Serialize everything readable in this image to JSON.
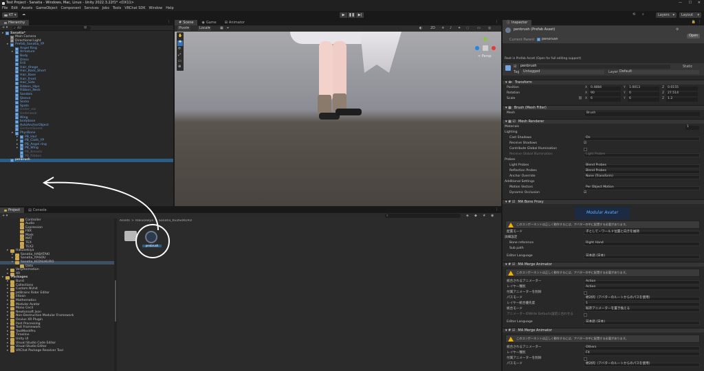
{
  "window": {
    "title": "Test Project - Sanatia - Windows, Mac, Linux - Unity 2022.3.22f1* <DX11>"
  },
  "menu": [
    "File",
    "Edit",
    "Assets",
    "GameObject",
    "Component",
    "Services",
    "Jobs",
    "Tools",
    "VRChat SDK",
    "Window",
    "Help"
  ],
  "toolbar": {
    "account": "KT",
    "layers": "Layers",
    "layout": "Layout"
  },
  "hierarchy": {
    "tab": "Hierarchy",
    "search_label": "All",
    "rows": [
      {
        "label": "Sanatia*",
        "i": 0,
        "c": "bold"
      },
      {
        "label": "Main Camera",
        "i": 1,
        "c": "go"
      },
      {
        "label": "Directional Light",
        "i": 1,
        "c": "go"
      },
      {
        "label": "Prefab_Sanatia_YP",
        "i": 1,
        "c": "blue"
      },
      {
        "label": "Angel Ring",
        "i": 2,
        "c": "blue"
      },
      {
        "label": "Armature",
        "i": 2,
        "c": "blue"
      },
      {
        "label": "Body",
        "i": 2,
        "c": "blue"
      },
      {
        "label": "Dress",
        "i": 2,
        "c": "blue"
      },
      {
        "label": "Frill",
        "i": 2,
        "c": "blue"
      },
      {
        "label": "Hair_Ahoge",
        "i": 2,
        "c": "blue"
      },
      {
        "label": "Hair_Back_Short",
        "i": 2,
        "c": "blue"
      },
      {
        "label": "Hair_Base",
        "i": 2,
        "c": "blue"
      },
      {
        "label": "Hair_Front",
        "i": 2,
        "c": "blue"
      },
      {
        "label": "Hair_Side",
        "i": 2,
        "c": "blue"
      },
      {
        "label": "Ribbon_Hips",
        "i": 2,
        "c": "blue"
      },
      {
        "label": "Ribbon_Neck",
        "i": 2,
        "c": "blue"
      },
      {
        "label": "Sandals",
        "i": 2,
        "c": "blue"
      },
      {
        "label": "Sleeve",
        "i": 2,
        "c": "blue"
      },
      {
        "label": "Socks",
        "i": 2,
        "c": "blue"
      },
      {
        "label": "Spats",
        "i": 2,
        "c": "blue"
      },
      {
        "label": "Under_ear",
        "i": 2,
        "c": "dim"
      },
      {
        "label": "Underwear",
        "i": 2,
        "c": "dim"
      },
      {
        "label": "Wing",
        "i": 2,
        "c": "blue"
      },
      {
        "label": "bodybase",
        "i": 2,
        "c": "blue"
      },
      {
        "label": "AutoAnchorObject",
        "i": 2,
        "c": "blue"
      },
      {
        "label": "GestureSound",
        "i": 2,
        "c": "dim"
      },
      {
        "label": "PhysBone",
        "i": 2,
        "c": "blue"
      },
      {
        "label": "PB_Hair",
        "i": 3,
        "c": "blue"
      },
      {
        "label": "PB_Cloth_YP",
        "i": 3,
        "c": "blue"
      },
      {
        "label": "PB_Angel ring",
        "i": 3,
        "c": "blue"
      },
      {
        "label": "PB_Wing",
        "i": 3,
        "c": "blue"
      },
      {
        "label": "PB_Breasts",
        "i": 3,
        "c": "dim"
      },
      {
        "label": "PB_Ribbon",
        "i": 3,
        "c": "dim"
      },
      {
        "label": "penbrush",
        "i": 1,
        "c": "blue"
      }
    ]
  },
  "scene": {
    "tabs": [
      "Scene",
      "Game",
      "Animator"
    ],
    "pivot": "Pivot",
    "local": "Local",
    "persp": "< Persp"
  },
  "project": {
    "tabs": [
      "Project",
      "Console"
    ],
    "breadcrumb": [
      "Assets",
      "Hakuseikya",
      "Sanatia_KEDSUKURO"
    ],
    "asset_label": "penbrush",
    "tree": [
      {
        "label": "Controller",
        "i": 3
      },
      {
        "label": "Audio",
        "i": 3
      },
      {
        "label": "Expression",
        "i": 3
      },
      {
        "label": "FBX",
        "i": 3
      },
      {
        "label": "Mask",
        "i": 3
      },
      {
        "label": "MAT",
        "i": 3
      },
      {
        "label": "TEX",
        "i": 3
      },
      {
        "label": "TEX2",
        "i": 3
      },
      {
        "label": "Hakusekiya",
        "i": 1
      },
      {
        "label": "Sanatia_HABATAKI",
        "i": 2
      },
      {
        "label": "Sanatia_IYASOU",
        "i": 2
      },
      {
        "label": "Sanatia_KEDSUKURO",
        "i": 2
      },
      {
        "label": "Data",
        "i": 3
      },
      {
        "label": "VeryAnimation",
        "i": 1
      },
      {
        "label": "XR",
        "i": 1
      },
      {
        "label": "Packages",
        "i": 0
      },
      {
        "label": "Burst",
        "i": 1
      },
      {
        "label": "Collections",
        "i": 1
      },
      {
        "label": "Custom NUnit",
        "i": 1
      },
      {
        "label": "JetBrains Rider Editor",
        "i": 1
      },
      {
        "label": "liltoon",
        "i": 1
      },
      {
        "label": "Mathematics",
        "i": 1
      },
      {
        "label": "Modular Avatar",
        "i": 1
      },
      {
        "label": "Mono Cecil",
        "i": 1
      },
      {
        "label": "Newtonsoft Json",
        "i": 1
      },
      {
        "label": "Non-Destructive Modular Framework",
        "i": 1
      },
      {
        "label": "Oculus XR Plugin",
        "i": 1
      },
      {
        "label": "Post Processing",
        "i": 1
      },
      {
        "label": "Test Framework",
        "i": 1
      },
      {
        "label": "TextMeshPro",
        "i": 1
      },
      {
        "label": "Timeline",
        "i": 1
      },
      {
        "label": "Unity UI",
        "i": 1
      },
      {
        "label": "Visual Studio Code Editor",
        "i": 1
      },
      {
        "label": "Visual Studio Editor",
        "i": 1
      },
      {
        "label": "VRChat Package Resolver Tool",
        "i": 1
      }
    ]
  },
  "inspector": {
    "tab": "Inspector",
    "asset": "penbrush (Prefab Asset)",
    "open": "Open",
    "parent_label": "Current Parent",
    "parent_value": "penbrush",
    "root_note": "Root in Prefab Asset (Open for full editing support)",
    "name": "penbrush",
    "static": "Static",
    "tag_label": "Tag",
    "tag": "Untagged",
    "layer_label": "Layer",
    "layer": "Default",
    "transform": {
      "title": "Transform",
      "rows": [
        {
          "label": "Position",
          "x": "0.4884",
          "y": "1.0013",
          "z": "0.0155"
        },
        {
          "label": "Rotation",
          "x": "90",
          "y": "0",
          "z": "27.514"
        },
        {
          "label": "Scale",
          "x": "6",
          "y": "6",
          "z": "1.2"
        }
      ]
    },
    "mesh_filter": {
      "title": "Brush (Mesh Filter)",
      "mesh_label": "Mesh",
      "mesh": "Brush"
    },
    "renderer": {
      "title": "Mesh Renderer",
      "materials": "Materials",
      "materials_count": "1",
      "lighting": "Lighting",
      "cast_shadows": "Cast Shadows",
      "cast_value": "On",
      "receive_shadows": "Receive Shadows",
      "contribute_gi": "Contribute Global Illumination",
      "receive_gi": "Receive Global Illumination",
      "receive_gi_value": "Light Probes",
      "probes": "Probes",
      "light_probes": "Light Probes",
      "light_value": "Blend Probes",
      "reflection_probes": "Reflection Probes",
      "reflection_value": "Blend Probes",
      "anchor_label": "Anchor Override",
      "anchor_value": "None (Transform)",
      "additional": "Additional Settings",
      "motion_label": "Motion Vectors",
      "motion_value": "Per Object Motion",
      "dynamic_label": "Dynamic Occlusion"
    },
    "bone_proxy": {
      "title": "MA Bone Proxy",
      "logo_top": "Modular",
      "logo_bottom": "Avatar",
      "warning": "このコンポーネントは正しく動作するには、アバターの中に配置する必要があります。",
      "mode_label": "配置モード",
      "mode_value": "子として・ワールド位置と向きを維持",
      "details": "詳細設定",
      "bone_label": "Bone reference",
      "bone_value": "Right Hand",
      "sub_label": "Sub path",
      "lang_label": "Editor Language",
      "lang_value": "日本語 (日本)"
    },
    "merge1": {
      "title": "MA Merge Animator",
      "warning": "このコンポーネントは正しく動作するには、アバターの中に配置する必要があります。",
      "anim_label": "統合されるアニメーター",
      "anim_value": "Action",
      "layer_label": "レイヤー種別",
      "layer_value": "Action",
      "delete_label": "付属アニメーターを削除",
      "path_label": "パスモード",
      "path_value": "絶対的（アバターのルートからのパスを使用）",
      "priority_label": "レイヤー統合優先度",
      "priority_value": "1",
      "merge_label": "統合モード",
      "merge_value": "既存アニメーターを置き換える",
      "wd_label": "アニメーターのWrite Defaults設定に合わせる",
      "lang_label": "Editor Language",
      "lang_value": "日本語 (日本)"
    },
    "merge2": {
      "title": "MA Merge Animator",
      "warning": "このコンポーネントは正しく動作するには、アバターの中に配置する必要があります。",
      "anim_label": "統合されるアニメーター",
      "anim_value": "Others",
      "layer_label": "レイヤー種別",
      "layer_value": "FX",
      "delete_label": "付属アニメーターを削除",
      "path_label": "パスモード",
      "path_value": "絶対的（アバターのルートからのパスを使用）"
    }
  },
  "colors": {
    "panel": "#282828",
    "accent": "#3a72b0",
    "blue_text": "#6fa7e5",
    "warning": "#f0b400"
  }
}
